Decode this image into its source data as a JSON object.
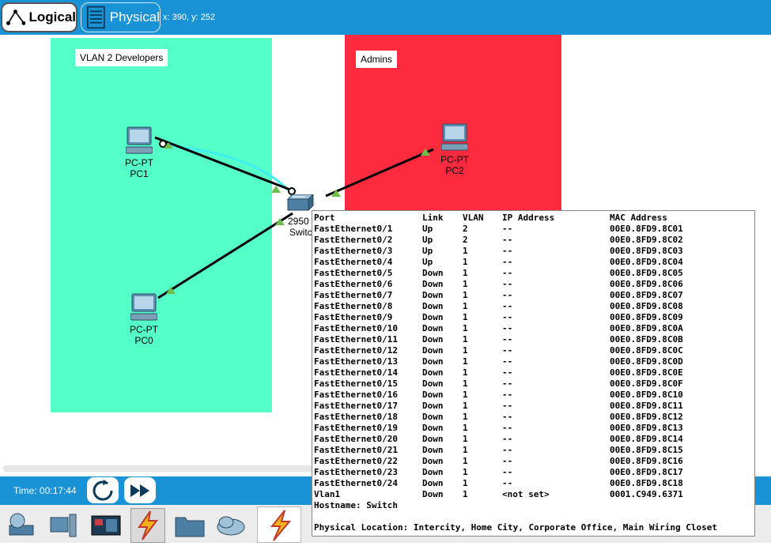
{
  "toolbar": {
    "logical_label": "Logical",
    "physical_label": "Physical",
    "coords": "x: 390, y: 252"
  },
  "workspace": {
    "areas": {
      "vlan2": "VLAN 2 Developers",
      "admins": "Admins"
    },
    "devices": {
      "pc1": {
        "type": "PC-PT",
        "name": "PC1"
      },
      "pc2": {
        "type": "PC-PT",
        "name": "PC2"
      },
      "pc0": {
        "type": "PC-PT",
        "name": "PC0"
      },
      "switch": {
        "type": "2950",
        "name": "Switch"
      }
    }
  },
  "colors": {
    "vlan2_area": "#55ffc8",
    "admins_area": "#fe2b3e",
    "toolbar": "#1a93d6",
    "link_up": "#6cc04a"
  },
  "simulation": {
    "time_label": "Time: 00:17:44",
    "reset_icon": "power-cycle-icon",
    "fast_forward_icon": "fast-forward-icon"
  },
  "palette": {
    "categories": [
      "network-devices-icon",
      "end-devices-icon",
      "components-icon",
      "connections-icon",
      "miscellaneous-icon",
      "multiuser-icon"
    ],
    "selected": "connections-icon"
  },
  "popup": {
    "headers": [
      "Port",
      "Link",
      "VLAN",
      "IP Address",
      "MAC Address"
    ],
    "rows": [
      [
        "FastEthernet0/1",
        "Up",
        "2",
        "--",
        "00E0.8FD9.8C01"
      ],
      [
        "FastEthernet0/2",
        "Up",
        "2",
        "--",
        "00E0.8FD9.8C02"
      ],
      [
        "FastEthernet0/3",
        "Up",
        "1",
        "--",
        "00E0.8FD9.8C03"
      ],
      [
        "FastEthernet0/4",
        "Up",
        "1",
        "--",
        "00E0.8FD9.8C04"
      ],
      [
        "FastEthernet0/5",
        "Down",
        "1",
        "--",
        "00E0.8FD9.8C05"
      ],
      [
        "FastEthernet0/6",
        "Down",
        "1",
        "--",
        "00E0.8FD9.8C06"
      ],
      [
        "FastEthernet0/7",
        "Down",
        "1",
        "--",
        "00E0.8FD9.8C07"
      ],
      [
        "FastEthernet0/8",
        "Down",
        "1",
        "--",
        "00E0.8FD9.8C08"
      ],
      [
        "FastEthernet0/9",
        "Down",
        "1",
        "--",
        "00E0.8FD9.8C09"
      ],
      [
        "FastEthernet0/10",
        "Down",
        "1",
        "--",
        "00E0.8FD9.8C0A"
      ],
      [
        "FastEthernet0/11",
        "Down",
        "1",
        "--",
        "00E0.8FD9.8C0B"
      ],
      [
        "FastEthernet0/12",
        "Down",
        "1",
        "--",
        "00E0.8FD9.8C0C"
      ],
      [
        "FastEthernet0/13",
        "Down",
        "1",
        "--",
        "00E0.8FD9.8C0D"
      ],
      [
        "FastEthernet0/14",
        "Down",
        "1",
        "--",
        "00E0.8FD9.8C0E"
      ],
      [
        "FastEthernet0/15",
        "Down",
        "1",
        "--",
        "00E0.8FD9.8C0F"
      ],
      [
        "FastEthernet0/16",
        "Down",
        "1",
        "--",
        "00E0.8FD9.8C10"
      ],
      [
        "FastEthernet0/17",
        "Down",
        "1",
        "--",
        "00E0.8FD9.8C11"
      ],
      [
        "FastEthernet0/18",
        "Down",
        "1",
        "--",
        "00E0.8FD9.8C12"
      ],
      [
        "FastEthernet0/19",
        "Down",
        "1",
        "--",
        "00E0.8FD9.8C13"
      ],
      [
        "FastEthernet0/20",
        "Down",
        "1",
        "--",
        "00E0.8FD9.8C14"
      ],
      [
        "FastEthernet0/21",
        "Down",
        "1",
        "--",
        "00E0.8FD9.8C15"
      ],
      [
        "FastEthernet0/22",
        "Down",
        "1",
        "--",
        "00E0.8FD9.8C16"
      ],
      [
        "FastEthernet0/23",
        "Down",
        "1",
        "--",
        "00E0.8FD9.8C17"
      ],
      [
        "FastEthernet0/24",
        "Down",
        "1",
        "--",
        "00E0.8FD9.8C18"
      ],
      [
        "Vlan1",
        "Down",
        "1",
        "<not set>",
        "0001.C949.6371"
      ]
    ],
    "hostname": "Hostname: Switch",
    "location": "Physical Location: Intercity, Home City, Corporate Office, Main Wiring Closet"
  }
}
